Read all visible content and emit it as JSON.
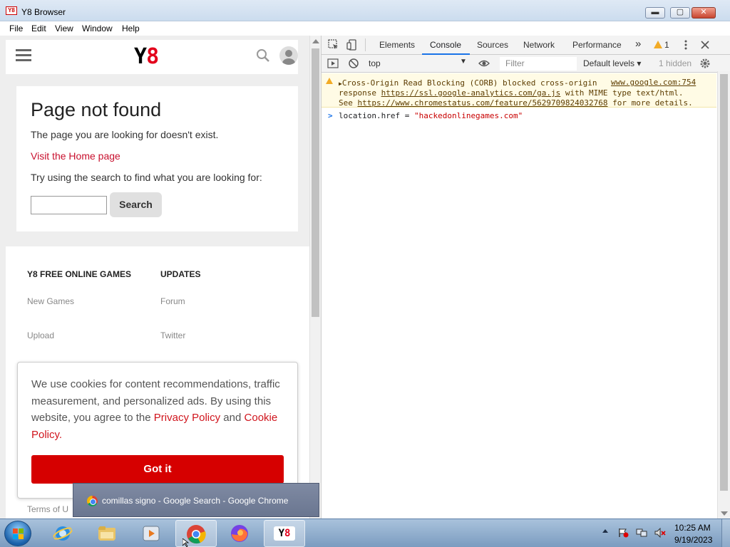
{
  "window": {
    "title": "Y8 Browser",
    "app_icon_text": "Y8",
    "buttons": {
      "minimize": "▬",
      "maximize": "▢",
      "close": "✕"
    }
  },
  "menu": [
    "File",
    "Edit",
    "View",
    "Window",
    "Help"
  ],
  "site": {
    "logo_y": "Y",
    "logo_8": "8",
    "not_found": {
      "title": "Page not found",
      "description": "The page you are looking for doesn't exist.",
      "home_link": "Visit the Home page",
      "hint": "Try using the search to find what you are looking for:",
      "search_value": "",
      "search_button": "Search"
    },
    "footer": {
      "col1_title": "Y8 FREE ONLINE GAMES",
      "col1_links": [
        "New Games",
        "Upload"
      ],
      "col2_title": "UPDATES",
      "col2_links": [
        "Forum",
        "Twitter"
      ],
      "terms": "Terms of U"
    },
    "cookie": {
      "text_1": "We use cookies for content recommendations, traffic measurement, and personalized ads. By using this website, you agree to the ",
      "privacy_link": "Privacy Policy",
      "and": " and ",
      "cookie_link": "Cookie Policy",
      "period": ".",
      "button": "Got it"
    }
  },
  "devtools": {
    "tabs": [
      "Elements",
      "Console",
      "Sources",
      "Network",
      "Performance"
    ],
    "active_tab": "Console",
    "more_tabs": "»",
    "warning_count": "1",
    "context": "top",
    "filter_placeholder": "Filter",
    "levels": "Default levels",
    "hidden": "1 hidden",
    "warning": {
      "line1": "Cross-Origin Read Blocking (CORB) blocked cross-origin",
      "source": "www.google.com:754",
      "line2_pre": "response ",
      "line2_url": "https://ssl.google-analytics.com/ga.js",
      "line2_post": " with MIME type text/html.",
      "line3_pre": "See ",
      "line3_url": "https://www.chromestatus.com/feature/5629709824032768",
      "line3_post": " for more details."
    },
    "input": {
      "prompt": ">",
      "code_pre": "location.href = ",
      "code_str": "\"hackedonlinegames.com\""
    }
  },
  "tooltip": {
    "text": "comillas signo - Google Search - Google Chrome"
  },
  "taskbar": {
    "time": "10:25 AM",
    "date": "9/19/2023"
  },
  "colors": {
    "accent_red": "#d60000",
    "link_red": "#c8102e",
    "taskbar": "#7b9cc0"
  }
}
